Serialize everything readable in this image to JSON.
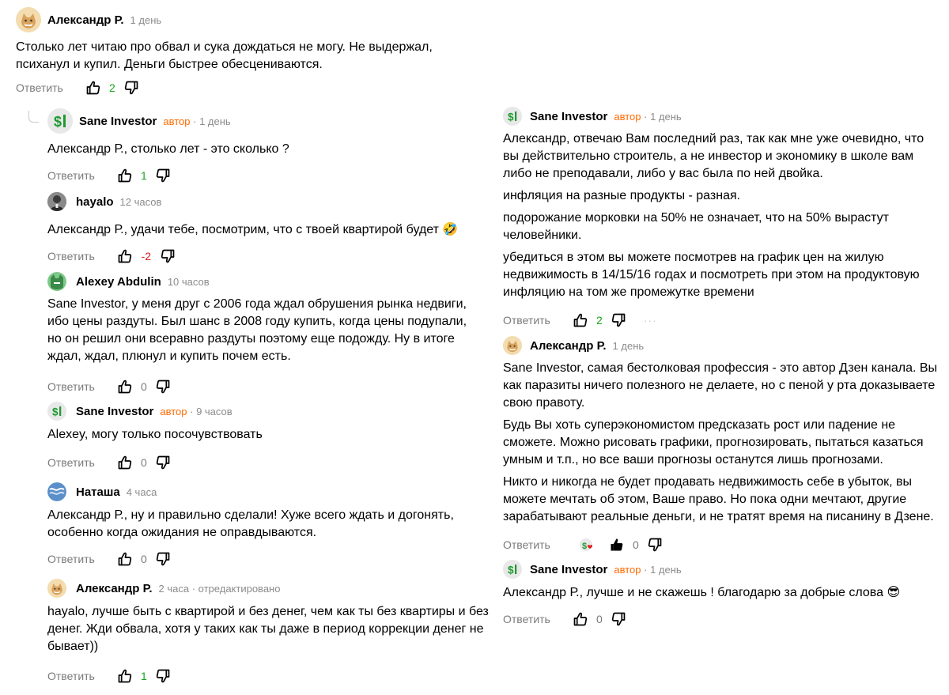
{
  "colors": {
    "author": "#ff6a00",
    "positive": "#17a317",
    "negative": "#e0201c",
    "meta": "#8b8b8b"
  },
  "labels": {
    "reply": "Ответить"
  },
  "left": [
    {
      "name": "Александр Р.",
      "author_badge": "",
      "time": "1 день",
      "avatar": "fox-avatar",
      "paragraphs": [
        "Столько лет читаю про обвал и сука дождаться не могу. Не выдержал, психанул и купил. Деньги быстрее обесцениваются."
      ],
      "rating": "2"
    },
    {
      "name": "Sane Investor",
      "author_badge": "автор",
      "time": "1 день",
      "avatar": "dollar-avatar",
      "paragraphs": [
        "Александр Р., столько лет - это сколько ?"
      ],
      "rating": "1"
    },
    {
      "name": "hayalo",
      "author_badge": "",
      "time": "12 часов",
      "avatar": "photo-avatar",
      "paragraphs": [
        "Александр Р., удачи тебе, посмотрим, что с твоей квартирой будет 🤣"
      ],
      "rating": "-2"
    },
    {
      "name": "Alexey Abdulin",
      "author_badge": "",
      "time": "10 часов",
      "avatar": "cat-avatar",
      "paragraphs": [
        "Sane Investor, у меня друг с 2006 года ждал обрушения рынка недвиги, ибо цены раздуты. Был шанс в 2008 году купить, когда цены подупали, но он решил они всеравно раздуты поэтому еще подожду. Ну в итоге ждал, ждал, плюнул и купить почем есть."
      ],
      "rating": "0"
    },
    {
      "name": "Sane Investor",
      "author_badge": "автор",
      "time": "9 часов",
      "avatar": "dollar-avatar",
      "paragraphs": [
        "Alexey, могу только посочувствовать"
      ],
      "rating": "0"
    },
    {
      "name": "Наташа",
      "author_badge": "",
      "time": "4 часа",
      "avatar": "wave-avatar",
      "paragraphs": [
        "Александр Р., ну и правильно сделали! Хуже всего ждать и догонять, особенно когда ожидания не оправдываются."
      ],
      "rating": "0"
    },
    {
      "name": "Александр Р.",
      "author_badge": "",
      "time": "2 часа · отредактировано",
      "avatar": "fox-avatar",
      "paragraphs": [
        "hayalo, лучше быть с квартирой и без денег, чем как ты без квартиры и без денег. Жди обвала, хотя у таких как ты даже в период коррекции денег не бывает))"
      ],
      "rating": "1"
    }
  ],
  "right": [
    {
      "name": "Sane Investor",
      "author_badge": "автор",
      "time": "1 день",
      "avatar": "dollar-avatar",
      "paragraphs": [
        "Александр, отвечаю Вам последний раз, так как мне уже очевидно, что вы действительно строитель, а не инвестор и экономику в школе вам либо не преподавали, либо у вас была по ней двойка.",
        "инфляция на разные продукты - разная.",
        "подорожание морковки на 50% не означает, что на 50% вырастут человейники.",
        "убедиться в этом вы можете посмотрев на график цен на жилую недвижимость в 14/15/16 годах и посмотреть при этом на продуктовую инфляцию на том же промежутке времени"
      ],
      "rating": "2",
      "more": "···"
    },
    {
      "name": "Александр Р.",
      "author_badge": "",
      "time": "1 день",
      "avatar": "fox-avatar",
      "paragraphs": [
        "Sane Investor, самая бестолковая профессия - это автор Дзен канала. Вы как паразиты ничего полезного не делаете, но с пеной у рта доказываете свою правоту.",
        "Будь Вы хоть суперэкономистом предсказать рост или падение не сможете. Можно рисовать графики, прогнозировать, пытаться казаться умным и т.п., но все ваши прогнозы останутся лишь прогнозами.",
        "Никто и никогда не будет продавать недвижимость себе в убыток, вы можете мечтать об этом, Ваше право. Но пока одни мечтают, другие зарабатывают реальные деньги, и не тратят время на писанину в Дзене."
      ],
      "rating": "0"
    },
    {
      "name": "Sane Investor",
      "author_badge": "автор",
      "time": "1 день",
      "avatar": "dollar-avatar",
      "paragraphs": [
        "Александр Р., лучше и не скажешь ! благодарю за добрые слова 😎"
      ],
      "rating": "0"
    }
  ]
}
